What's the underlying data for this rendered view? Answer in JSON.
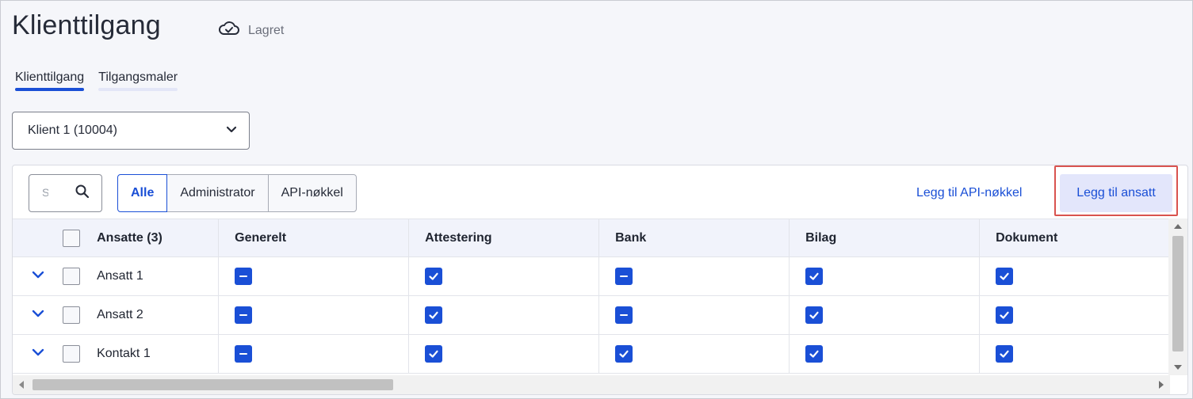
{
  "header": {
    "title": "Klienttilgang",
    "status_icon": "cloud-check-icon",
    "status_text": "Lagret"
  },
  "tabs": [
    {
      "label": "Klienttilgang",
      "active": true
    },
    {
      "label": "Tilgangsmaler",
      "active": false
    }
  ],
  "client_select": {
    "value": "Klient 1 (10004)",
    "icon": "chevron-down-icon"
  },
  "toolbar": {
    "search_placeholder": "S",
    "search_icon": "search-icon",
    "filters": [
      {
        "label": "Alle",
        "active": true
      },
      {
        "label": "Administrator",
        "active": false
      },
      {
        "label": "API-nøkkel",
        "active": false
      }
    ],
    "add_api_key_label": "Legg til API-nøkkel",
    "add_employee_label": "Legg til ansatt"
  },
  "table": {
    "name_header": "Ansatte (3)",
    "columns": [
      "Generelt",
      "Attestering",
      "Bank",
      "Bilag",
      "Dokument"
    ],
    "rows": [
      {
        "name": "Ansatt 1",
        "states": [
          "partial",
          "checked",
          "partial",
          "checked",
          "checked"
        ]
      },
      {
        "name": "Ansatt 2",
        "states": [
          "partial",
          "checked",
          "partial",
          "checked",
          "checked"
        ]
      },
      {
        "name": "Kontakt 1",
        "states": [
          "partial",
          "checked",
          "checked",
          "checked",
          "checked"
        ]
      }
    ]
  },
  "colors": {
    "accent": "#1a4fd6",
    "highlight_border": "#d9534f",
    "button_bg": "#e3e6fb"
  }
}
